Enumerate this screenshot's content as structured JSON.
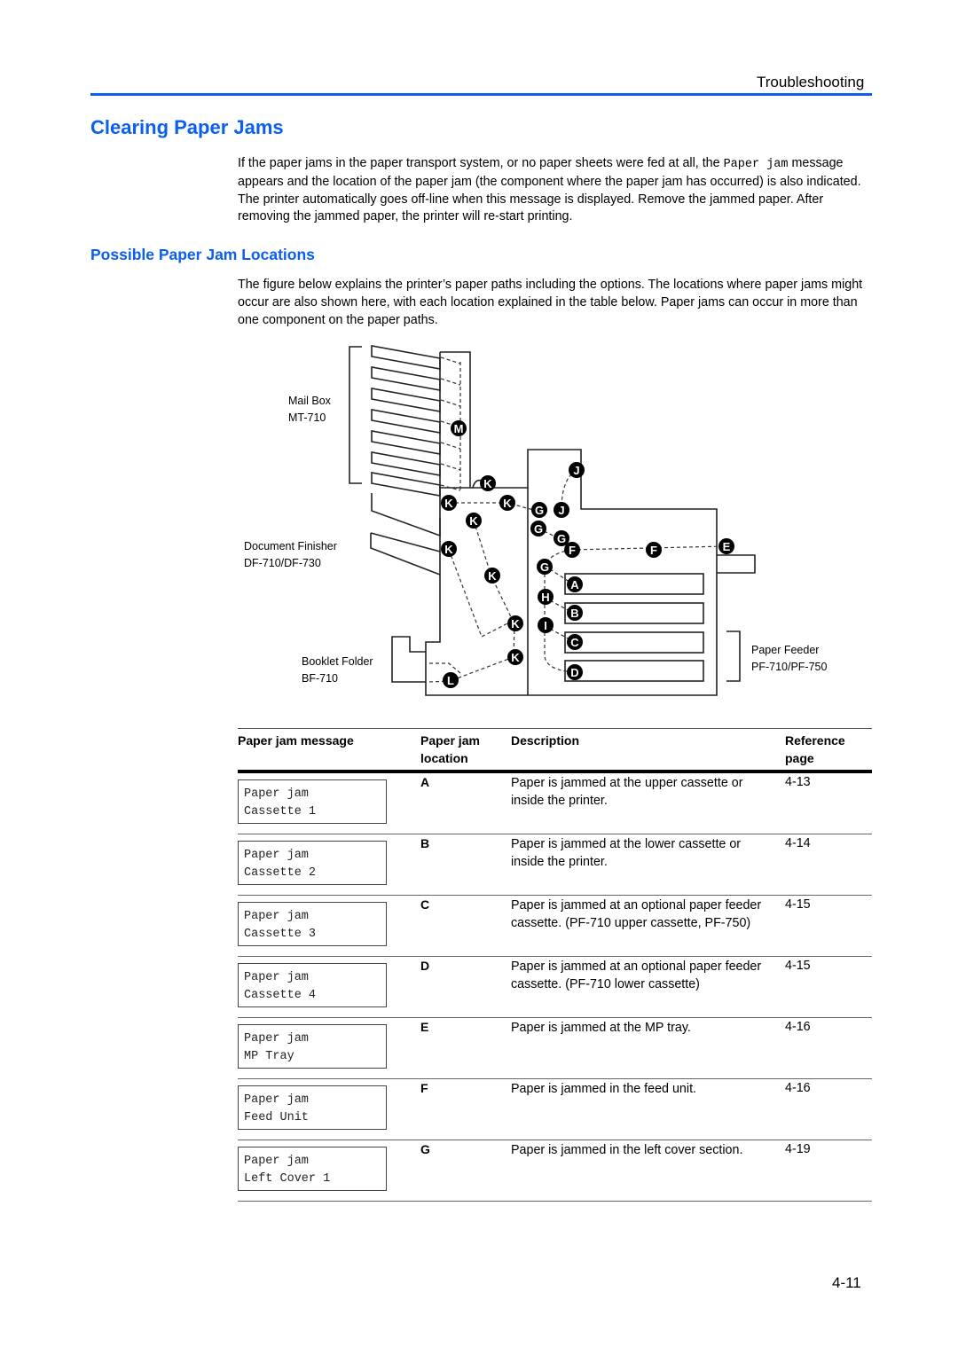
{
  "header": {
    "section": "Troubleshooting",
    "accent_color": "#0a5ff0"
  },
  "title": "Clearing Paper Jams",
  "intro": {
    "before_code": "If the paper jams in the paper transport system, or no paper sheets were fed at all, the ",
    "code": "Paper jam",
    "after_code": " message appears and the location of the paper jam (the component where the paper jam has occurred) is also indicated. The printer automatically goes off-line when this message is displayed. Remove the jammed paper. After removing the jammed paper, the printer will re-start printing."
  },
  "subsection": {
    "title": "Possible Paper Jam Locations",
    "text": "The figure below explains the printer’s paper paths including the options. The locations where paper jams might occur are also shown here, with each location explained in the table below. Paper jams can occur in more than one component on the paper paths."
  },
  "diagram": {
    "labels": {
      "mailbox": [
        "Mail Box",
        "MT-710"
      ],
      "finisher": [
        "Document Finisher",
        "DF-710/DF-730"
      ],
      "folder": [
        "Booklet Folder",
        "BF-710"
      ],
      "feeder": [
        "Paper Feeder",
        "PF-710/PF-750"
      ]
    },
    "markers": [
      "M",
      "K",
      "K",
      "K",
      "K",
      "K",
      "K",
      "K",
      "K",
      "J",
      "J",
      "G",
      "G",
      "G",
      "G",
      "F",
      "F",
      "E",
      "A",
      "B",
      "C",
      "D",
      "H",
      "I",
      "L"
    ]
  },
  "table": {
    "headers": {
      "message": "Paper jam message",
      "location_1": "Paper jam",
      "location_2": "location",
      "description": "Description",
      "reference_1": "Reference",
      "reference_2": "page"
    },
    "rows": [
      {
        "msg1": "Paper jam",
        "msg2": "Cassette 1",
        "location": "A",
        "description": "Paper is jammed at the upper cassette or inside the printer.",
        "reference": "4-13"
      },
      {
        "msg1": "Paper jam",
        "msg2": "Cassette 2",
        "location": "B",
        "description": "Paper is jammed at the lower cassette or inside the printer.",
        "reference": "4-14"
      },
      {
        "msg1": "Paper jam",
        "msg2": "Cassette 3",
        "location": "C",
        "description": "Paper is jammed at an optional paper feeder cassette. (PF-710 upper cassette, PF-750)",
        "reference": "4-15"
      },
      {
        "msg1": "Paper jam",
        "msg2": "Cassette 4",
        "location": "D",
        "description": "Paper is jammed at an optional paper feeder cassette. (PF-710 lower cassette)",
        "reference": "4-15"
      },
      {
        "msg1": "Paper jam",
        "msg2": "MP Tray",
        "location": "E",
        "description": "Paper is jammed at the MP tray.",
        "reference": "4-16"
      },
      {
        "msg1": "Paper jam",
        "msg2": "Feed Unit",
        "location": "F",
        "description": "Paper is jammed in the feed unit.",
        "reference": "4-16"
      },
      {
        "msg1": "Paper jam",
        "msg2": "Left Cover 1",
        "location": "G",
        "description": "Paper is jammed in the left cover section.",
        "reference": "4-19"
      }
    ]
  },
  "footer": {
    "page_number": "4-11"
  }
}
